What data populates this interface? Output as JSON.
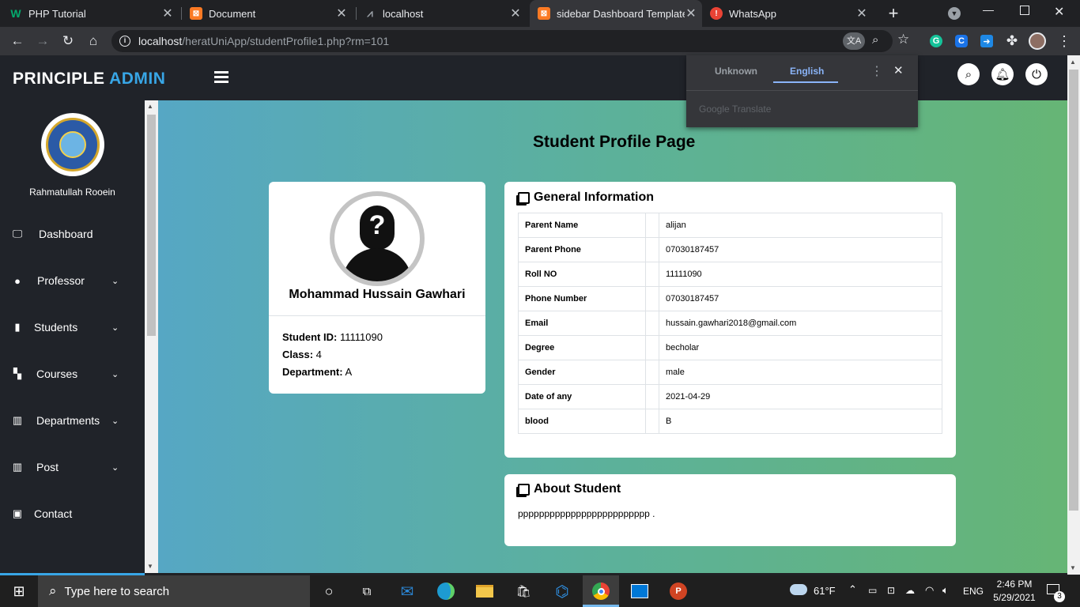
{
  "browser": {
    "tabs": [
      {
        "title": "PHP Tutorial",
        "favicon": "W",
        "favicon_color": "#04aa6d"
      },
      {
        "title": "Document",
        "favicon": "⊠",
        "favicon_color": "#fb7a24"
      },
      {
        "title": "localhost",
        "favicon": "⩘",
        "favicon_color": "#9aa0a6"
      },
      {
        "title": "sidebar Dashboard Template",
        "favicon": "⊠",
        "favicon_color": "#fb7a24"
      },
      {
        "title": "WhatsApp",
        "favicon": "!",
        "favicon_color": "#ea4335"
      }
    ],
    "url_host": "localhost",
    "url_path": "/heratUniApp/studentProfile1.php?rm=101"
  },
  "translate": {
    "tab_unknown": "Unknown",
    "tab_english": "English",
    "brand": "Google Translate"
  },
  "app": {
    "brand_part1": "PRINCIPLE",
    "brand_part2": "ADMIN",
    "user_name": "Rahmatullah Rooein",
    "nav": [
      {
        "label": "Dashboard",
        "icon": "monitor-icon",
        "chevron": false
      },
      {
        "label": "Professor",
        "icon": "user-circle-icon",
        "chevron": true
      },
      {
        "label": "Students",
        "icon": "book-icon",
        "chevron": true
      },
      {
        "label": "Courses",
        "icon": "teacher-icon",
        "chevron": true
      },
      {
        "label": "Departments",
        "icon": "building-icon",
        "chevron": true
      },
      {
        "label": "Post",
        "icon": "building-icon",
        "chevron": true
      },
      {
        "label": "Contact",
        "icon": "address-book-icon",
        "chevron": false
      }
    ]
  },
  "page": {
    "title": "Student Profile Page",
    "profile": {
      "name": "Mohammad Hussain Gawhari",
      "student_id_label": "Student ID:",
      "student_id": "11111090",
      "class_label": "Class:",
      "class": "4",
      "department_label": "Department:",
      "department": "A"
    },
    "general_title": "General Information",
    "general_rows": [
      {
        "label": "Parent Name",
        "value": "alijan"
      },
      {
        "label": "Parent Phone",
        "value": "07030187457"
      },
      {
        "label": "Roll NO",
        "value": "11111090"
      },
      {
        "label": "Phone Number",
        "value": "07030187457"
      },
      {
        "label": "Email",
        "value": "hussain.gawhari2018@gmail.com"
      },
      {
        "label": "Degree",
        "value": "becholar"
      },
      {
        "label": "Gender",
        "value": "male"
      },
      {
        "label": "Date of any",
        "value": "2021-04-29"
      },
      {
        "label": "blood",
        "value": "B"
      }
    ],
    "about_title": "About Student",
    "about_text": "ppppppppppppppppppppppppp ."
  },
  "taskbar": {
    "search_placeholder": "Type here to search",
    "weather": "61°F",
    "lang": "ENG",
    "time": "2:46 PM",
    "date": "5/29/2021",
    "notifications": "3"
  }
}
